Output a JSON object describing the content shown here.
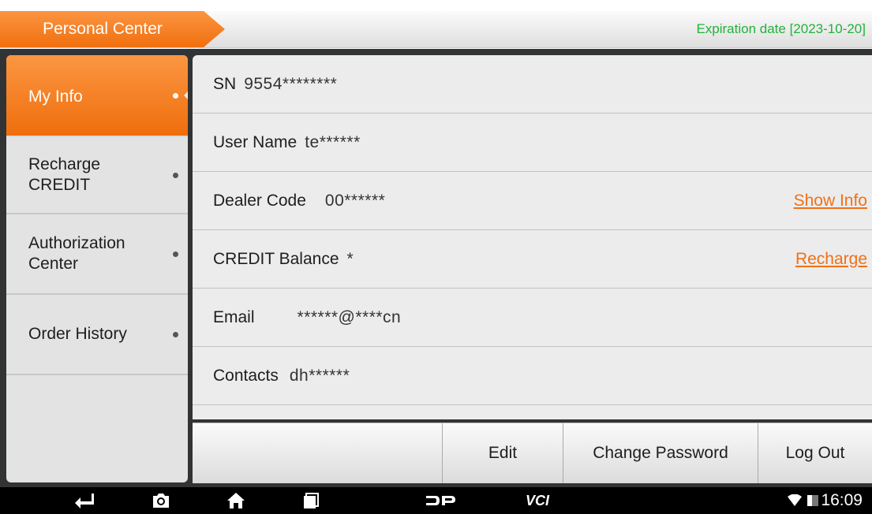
{
  "header": {
    "title": "Personal Center",
    "expiration": "Expiration date [2023-10-20]"
  },
  "sidebar": {
    "items": [
      {
        "label": "My Info",
        "active": true
      },
      {
        "label": "Recharge\nCREDIT",
        "active": false
      },
      {
        "label": "Authorization\nCenter",
        "active": false
      },
      {
        "label": "Order History",
        "active": false
      }
    ]
  },
  "info": {
    "sn": {
      "label": "SN",
      "value": "9554********"
    },
    "username": {
      "label": "User Name",
      "value": "te******"
    },
    "dealer": {
      "label": "Dealer Code",
      "value": "00******",
      "action": "Show Info"
    },
    "credit": {
      "label": "CREDIT Balance",
      "value": "*",
      "action": "Recharge"
    },
    "email": {
      "label": "Email",
      "value": "******@****cn"
    },
    "contacts": {
      "label": "Contacts",
      "value": "dh******"
    }
  },
  "footer": {
    "edit": "Edit",
    "change_password": "Change Password",
    "logout": "Log Out"
  },
  "navbar": {
    "time": "16:09",
    "icons": [
      "back-icon",
      "camera-icon",
      "home-icon",
      "recent-apps-icon",
      "dp-icon",
      "vci-icon",
      "wifi-icon",
      "battery-icon"
    ]
  },
  "colors": {
    "accent": "#f07116",
    "expiry": "#22b23a",
    "dark_bg": "#323335"
  }
}
